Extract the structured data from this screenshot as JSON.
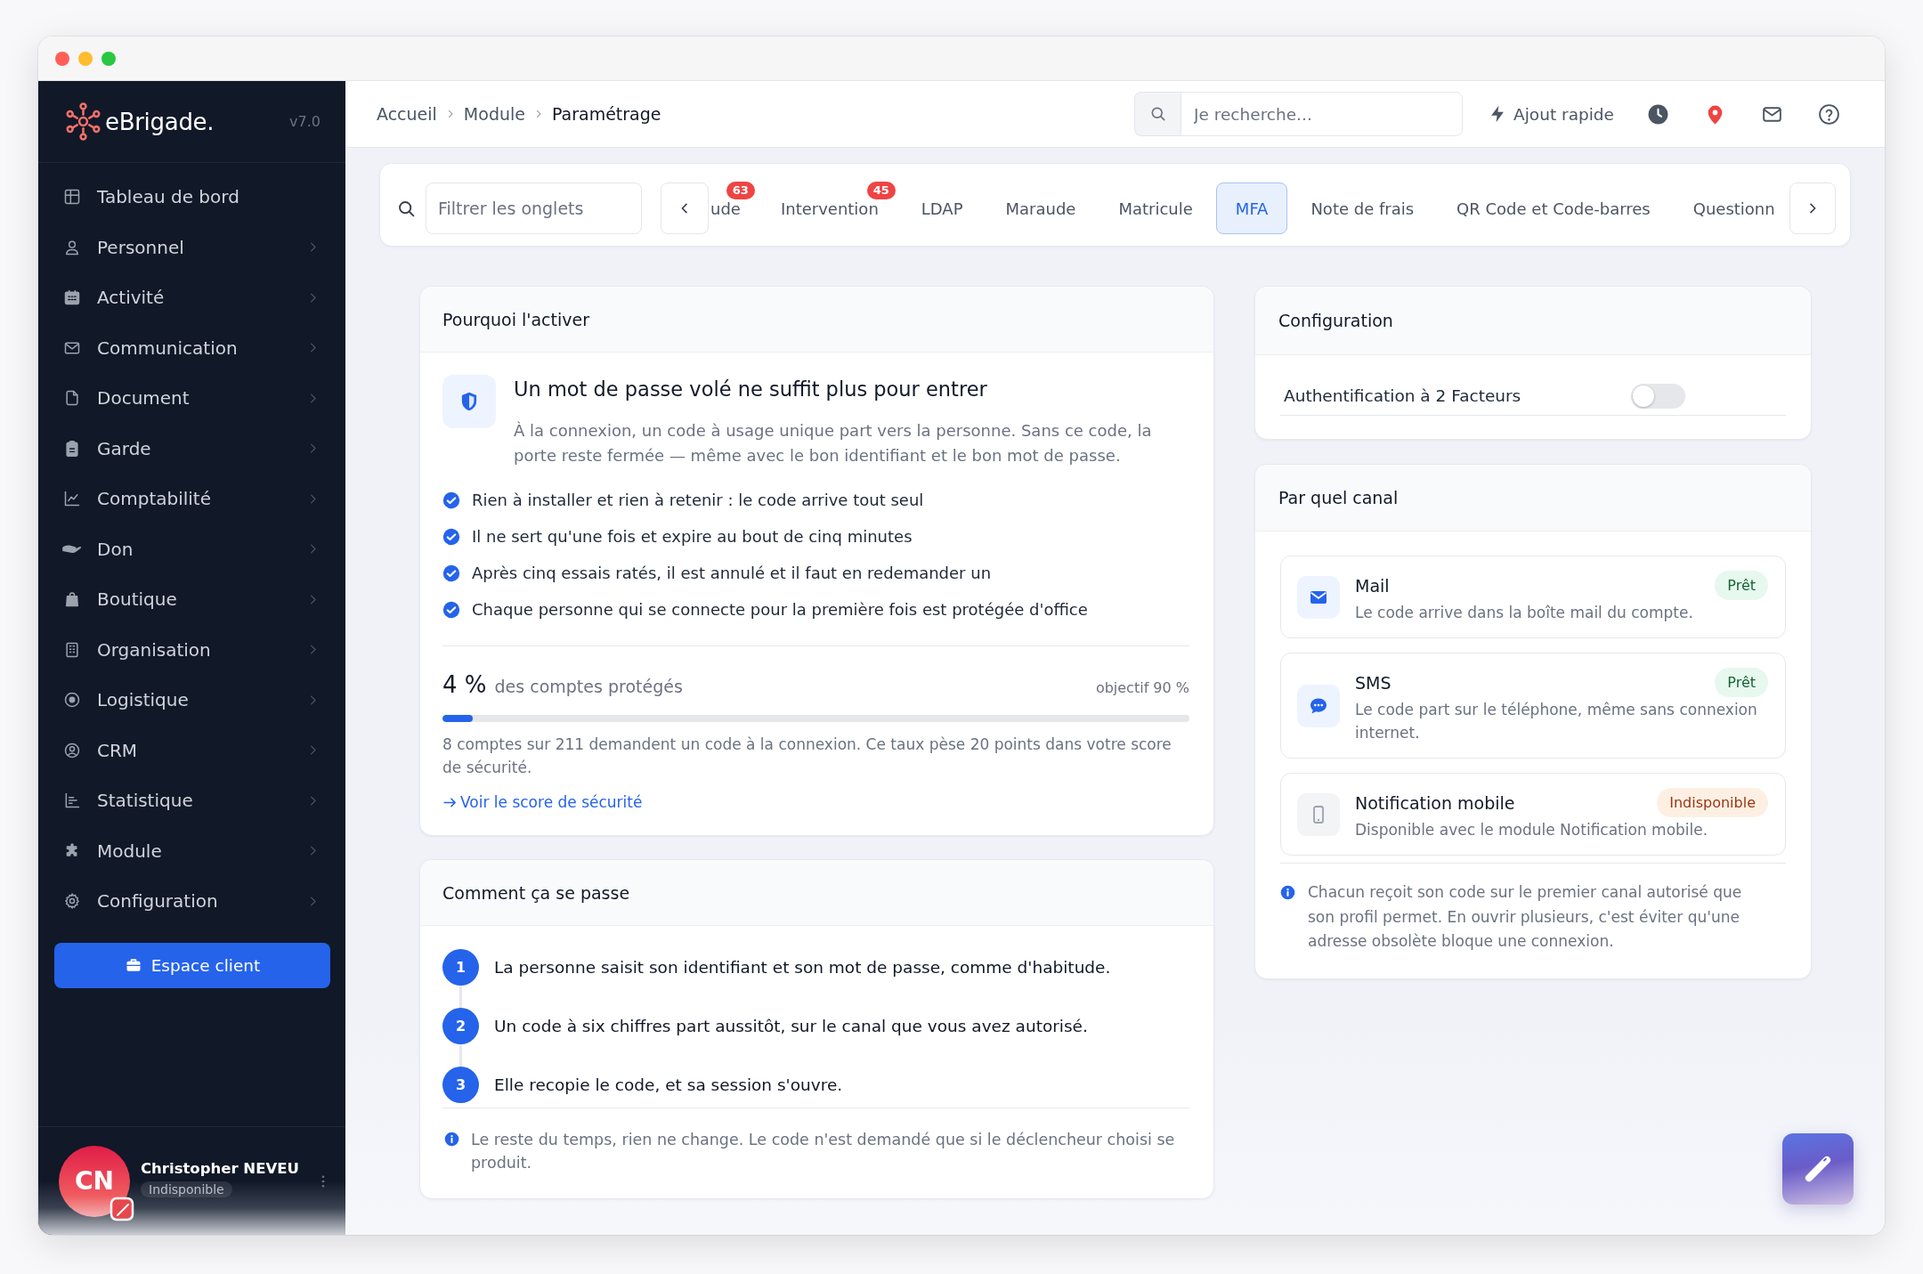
{
  "sidebar": {
    "logo": "eBrigade.",
    "version": "v7.0",
    "items": [
      {
        "label": "Tableau de bord",
        "expandable": false
      },
      {
        "label": "Personnel",
        "expandable": true
      },
      {
        "label": "Activité",
        "expandable": true
      },
      {
        "label": "Communication",
        "expandable": true
      },
      {
        "label": "Document",
        "expandable": true
      },
      {
        "label": "Garde",
        "expandable": true
      },
      {
        "label": "Comptabilité",
        "expandable": true
      },
      {
        "label": "Don",
        "expandable": true
      },
      {
        "label": "Boutique",
        "expandable": true
      },
      {
        "label": "Organisation",
        "expandable": true
      },
      {
        "label": "Logistique",
        "expandable": true
      },
      {
        "label": "CRM",
        "expandable": true
      },
      {
        "label": "Statistique",
        "expandable": true
      },
      {
        "label": "Module",
        "expandable": true
      },
      {
        "label": "Configuration",
        "expandable": true
      }
    ],
    "cta": "Espace client",
    "user": {
      "initials": "CN",
      "name": "Christopher NEVEU",
      "status": "Indisponible"
    }
  },
  "topbar": {
    "breadcrumb": [
      {
        "label": "Accueil",
        "current": false
      },
      {
        "label": "Module",
        "current": false
      },
      {
        "label": "Paramétrage",
        "current": true
      }
    ],
    "search": {
      "placeholder": "Je recherche..."
    },
    "quick_add": "Ajout rapide"
  },
  "tab_bar": {
    "filter": {
      "placeholder": "Filtrer les onglets"
    },
    "tabs": [
      {
        "label": "ude",
        "badge": "63",
        "selected": false
      },
      {
        "label": "Intervention",
        "badge": "45",
        "selected": false
      },
      {
        "label": "LDAP",
        "selected": false
      },
      {
        "label": "Maraude",
        "selected": false
      },
      {
        "label": "Matricule",
        "selected": false
      },
      {
        "label": "MFA",
        "selected": true
      },
      {
        "label": "Note de frais",
        "selected": false
      },
      {
        "label": "QR Code et Code-barres",
        "selected": false
      },
      {
        "label": "Questionn",
        "selected": false
      }
    ]
  },
  "why_card": {
    "title": "Pourquoi l'activer",
    "headline": "Un mot de passe volé ne suffit plus pour entrer",
    "description": "À la connexion, un code à usage unique part vers la personne. Sans ce code, la porte reste fermée — même avec le bon identifiant et le bon mot de passe.",
    "benefits": [
      "Rien à installer et rien à retenir : le code arrive tout seul",
      "Il ne sert qu'une fois et expire au bout de cinq minutes",
      "Après cinq essais ratés, il est annulé et il faut en redemander un",
      "Chaque personne qui se connecte pour la première fois est protégée d'office"
    ],
    "stat": {
      "value": "4 %",
      "label": "des comptes protégés",
      "target": "objectif 90 %",
      "level": 0.04,
      "note": "8 comptes sur 211 demandent un code à la connexion. Ce taux pèse 20 points dans votre score de sécurité.",
      "link": "Voir le score de sécurité"
    }
  },
  "steps_card": {
    "title": "Comment ça se passe",
    "steps": [
      {
        "number": "1",
        "text": "La personne saisit son identifiant et son mot de passe, comme d'habitude."
      },
      {
        "number": "2",
        "text": "Un code à six chiffres part aussitôt, sur le canal que vous avez autorisé."
      },
      {
        "number": "3",
        "text": "Elle recopie le code, et sa session s'ouvre."
      }
    ],
    "note": "Le reste du temps, rien ne change. Le code n'est demandé que si le déclencheur choisi se produit."
  },
  "config_card": {
    "title": "Configuration",
    "settings": [
      {
        "label": "Authentification à 2 Facteurs",
        "on": false
      }
    ]
  },
  "channels_card": {
    "title": "Par quel canal",
    "channels": [
      {
        "kind": "mail",
        "name": "Mail",
        "description": "Le code arrive dans la boîte mail du compte.",
        "status": "Prêt",
        "available": true
      },
      {
        "kind": "sms",
        "name": "SMS",
        "description": "Le code part sur le téléphone, même sans connexion internet.",
        "status": "Prêt",
        "available": true
      },
      {
        "kind": "mobile",
        "name": "Notification mobile",
        "description": "Disponible avec le module Notification mobile.",
        "status": "Indisponible",
        "available": false
      }
    ],
    "note": "Chacun reçoit son code sur le premier canal autorisé que son profil permet. En ouvrir plusieurs, c'est éviter qu'une adresse obsolète bloque une connexion."
  }
}
